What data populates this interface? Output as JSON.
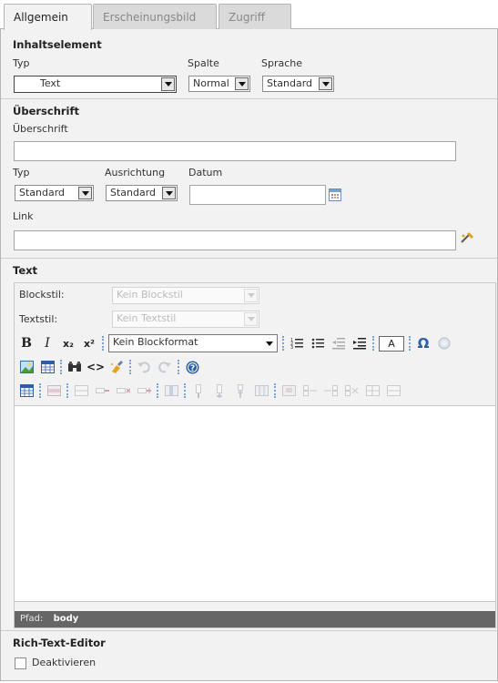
{
  "tabs": [
    "Allgemein",
    "Erscheinungsbild",
    "Zugriff"
  ],
  "content_element": {
    "title": "Inhaltselement",
    "type_label": "Typ",
    "type_value": "Text",
    "column_label": "Spalte",
    "column_value": "Normal",
    "language_label": "Sprache",
    "language_value": "Standard"
  },
  "header": {
    "title": "Überschrift",
    "header_label": "Überschrift",
    "header_value": "",
    "type_label": "Typ",
    "type_value": "Standard",
    "align_label": "Ausrichtung",
    "align_value": "Standard",
    "date_label": "Datum",
    "date_value": "",
    "link_label": "Link",
    "link_value": ""
  },
  "text": {
    "title": "Text",
    "blockstyle_label": "Blockstil:",
    "blockstyle_value": "Kein Blockstil",
    "textstyle_label": "Textstil:",
    "textstyle_value": "Kein Textstil",
    "blockformat_value": "Kein Blockformat",
    "path_label": "Pfad:",
    "path_value": "body"
  },
  "rte": {
    "title": "Rich-Text-Editor",
    "disable_label": "Deaktivieren"
  },
  "toolbar": {
    "bold": "B",
    "italic": "I",
    "subscript": "x₂",
    "superscript": "x²",
    "textcolor": "A",
    "omega": "Ω",
    "code": "<>"
  },
  "colors": {
    "tab_active": "#f2f2f2",
    "panel": "#f2f2f2",
    "pathbar": "#666666",
    "accent_blue": "#2d5fa6"
  }
}
